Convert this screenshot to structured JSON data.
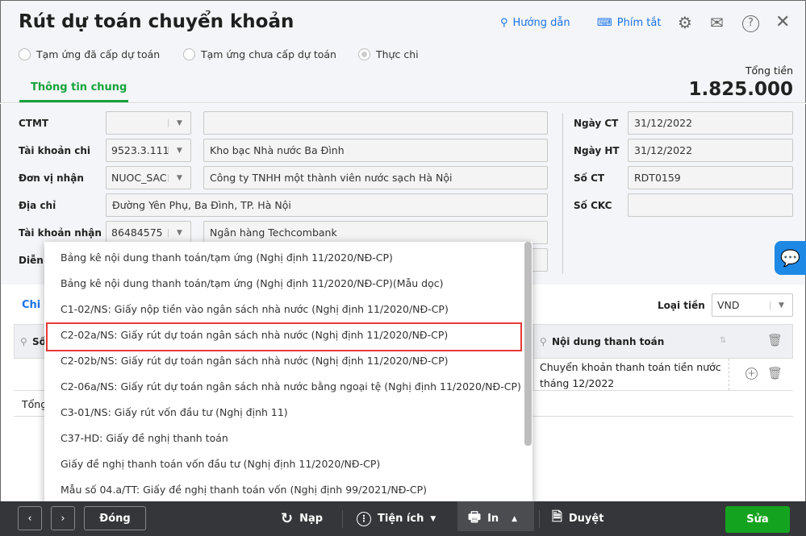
{
  "header": {
    "title": "Rút dự toán chuyển khoản",
    "guide": "Hướng dẫn",
    "shortcuts": "Phím tắt",
    "total_label": "Tổng tiền",
    "total_value": "1.825.000"
  },
  "radios": [
    {
      "label": "Tạm ứng đã cấp dự toán",
      "checked": false
    },
    {
      "label": "Tạm ứng chưa cấp dự toán",
      "checked": false
    },
    {
      "label": "Thực chi",
      "checked": true
    }
  ],
  "tabs": {
    "general": "Thông tin chung"
  },
  "form": {
    "ctmt": {
      "label": "CTMT",
      "code": "",
      "name": ""
    },
    "tk_chi": {
      "label": "Tài khoản chi",
      "code": "9523.3.111",
      "name": "Kho bạc Nhà nước Ba Đình"
    },
    "don_vi": {
      "label": "Đơn vị nhận",
      "code": "NUOC_SAC",
      "name": "Công ty TNHH một thành viên nước sạch Hà Nội"
    },
    "dia_chi": {
      "label": "Địa chỉ",
      "value": "Đường Yên Phụ, Ba Đình, TP. Hà Nội"
    },
    "tk_nhan": {
      "label": "Tài khoản nhận",
      "code": "86484575",
      "name": "Ngân hàng Techcombank"
    },
    "dien_giai": {
      "label": "Diễn g"
    },
    "ngay_ct": {
      "label": "Ngày CT",
      "value": "31/12/2022"
    },
    "ngay_ht": {
      "label": "Ngày HT",
      "value": "31/12/2022"
    },
    "so_ct": {
      "label": "Số CT",
      "value": "RDT0159"
    },
    "so_ckc": {
      "label": "Số CKC",
      "value": ""
    }
  },
  "detail": {
    "tab": "Chi t",
    "currency_label": "Loại tiền",
    "currency": "VND",
    "col_so": "Số",
    "col_content": "Nội dung thanh toán",
    "row_content": "Chuyển khoản thanh toán tiền nước tháng 12/2022",
    "total": "Tổng"
  },
  "dropdown": {
    "items": [
      "Bảng kê nội dung thanh toán/tạm ứng (Nghị định 11/2020/NĐ-CP)",
      "Bảng kê nội dung thanh toán/tạm ứng (Nghị định 11/2020/NĐ-CP)(Mẫu dọc)",
      "C1-02/NS: Giấy nộp tiền vào ngân sách nhà nước (Nghị định 11/2020/NĐ-CP)",
      "C2-02a/NS: Giấy rút dự toán ngân sách nhà nước (Nghị định 11/2020/NĐ-CP)",
      "C2-02b/NS: Giấy rút dự toán ngân sách nhà nước (Nghị định 11/2020/NĐ-CP)",
      "C2-06a/NS: Giấy rút dự toán ngân sách nhà nước bằng ngoại tệ (Nghị định 11/2020/NĐ-CP)",
      "C3-01/NS: Giấy rút vốn đầu tư (Nghị định 11)",
      "C37-HD: Giấy đề nghị thanh toán",
      "Giấy đề nghị thanh toán vốn đầu tư (Nghị định 11/2020/NĐ-CP)",
      "Mẫu số 04.a/TT: Giấy đề nghị thanh toán vốn (Nghị định 99/2021/NĐ-CP)"
    ],
    "highlighted_index": 3
  },
  "toolbar": {
    "close": "Đóng",
    "reload": "Nạp",
    "utilities": "Tiện ích",
    "print": "In",
    "approve": "Duyệt",
    "edit": "Sửa"
  },
  "colors": {
    "accent_green": "#15a33b",
    "link_blue": "#1a73e8",
    "highlight_red": "#e8393a",
    "toolbar_bg": "#35363a"
  }
}
